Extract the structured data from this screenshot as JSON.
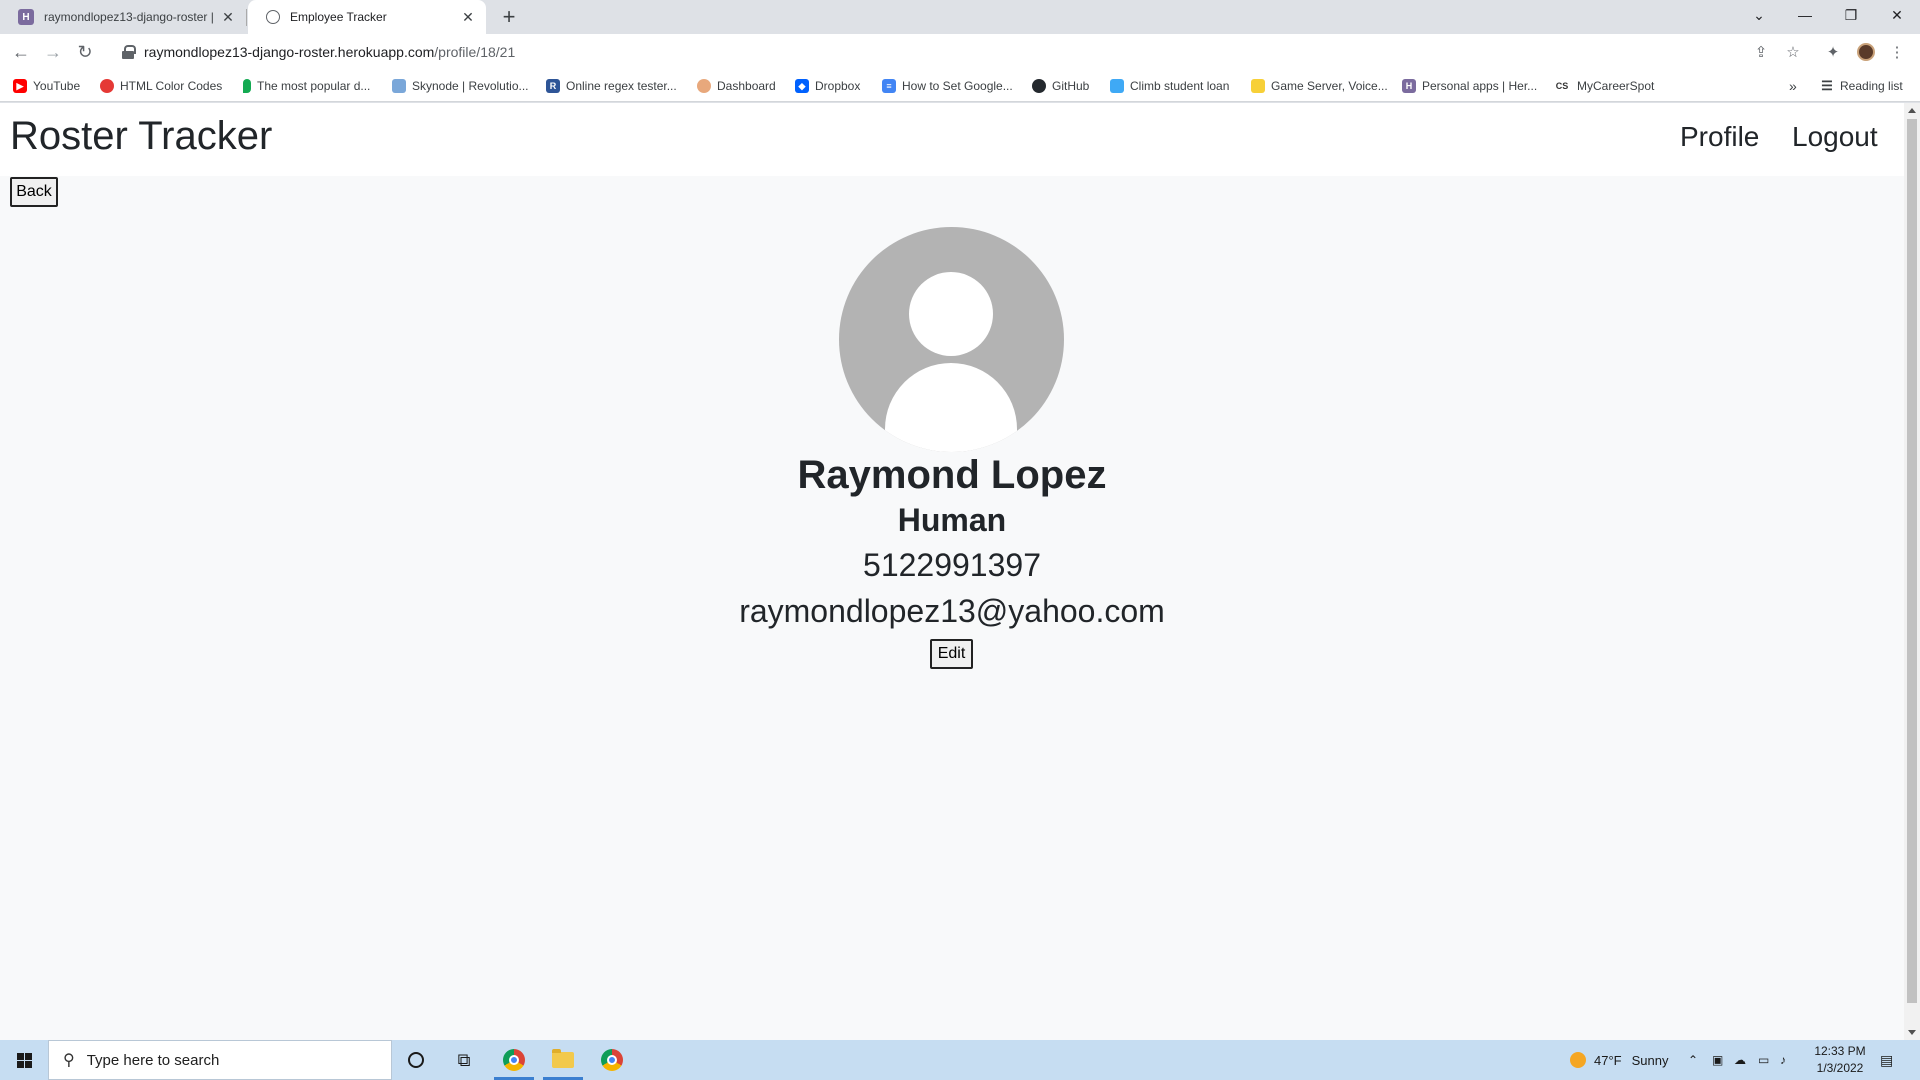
{
  "browser": {
    "tabs": [
      {
        "title": "raymondlopez13-django-roster |",
        "icon": "heroku-icon",
        "active": false
      },
      {
        "title": "Employee Tracker",
        "icon": "globe-icon",
        "active": true
      }
    ],
    "new_tab_symbol": "+",
    "url_host": "raymondlopez13-django-roster.herokuapp.com",
    "url_path": "/profile/18/21",
    "bookmarks": [
      {
        "label": "YouTube",
        "icon": "youtube-icon",
        "color": "#ff0000"
      },
      {
        "label": "HTML Color Codes",
        "icon": "color-codes-icon",
        "color": "#e53935"
      },
      {
        "label": "The most popular d...",
        "icon": "mongodb-leaf-icon",
        "color": "#13aa52"
      },
      {
        "label": "Skynode | Revolutio...",
        "icon": "skynode-icon",
        "color": "#7aa7d9"
      },
      {
        "label": "Online regex tester...",
        "icon": "regex-icon",
        "color": "#2e5597"
      },
      {
        "label": "Dashboard",
        "icon": "dashboard-icon",
        "color": "#e8a87c"
      },
      {
        "label": "Dropbox",
        "icon": "dropbox-icon",
        "color": "#0061fe"
      },
      {
        "label": "How to Set Google...",
        "icon": "google-docs-icon",
        "color": "#4285f4"
      },
      {
        "label": "GitHub",
        "icon": "github-icon",
        "color": "#24292e"
      },
      {
        "label": "Climb student loan",
        "icon": "climb-icon",
        "color": "#3fa9f5"
      },
      {
        "label": "Game Server, Voice...",
        "icon": "game-server-icon",
        "color": "#f7d038"
      },
      {
        "label": "Personal apps | Her...",
        "icon": "heroku-icon",
        "color": "#7b6b9e"
      },
      {
        "label": "MyCareerSpot",
        "icon": "cs-icon",
        "color": "#333333"
      }
    ],
    "bookmarks_overflow": "»",
    "reading_list": "Reading list"
  },
  "page": {
    "brand": "Roster Tracker",
    "nav": {
      "profile": "Profile",
      "logout": "Logout"
    },
    "back_button": "Back",
    "profile": {
      "name": "Raymond Lopez",
      "role": "Human",
      "phone": "5122991397",
      "email": "raymondlopez13@yahoo.com"
    },
    "edit_button": "Edit"
  },
  "taskbar": {
    "search_placeholder": "Type here to search",
    "weather_temp": "47°F",
    "weather_text": "Sunny",
    "time": "12:33 PM",
    "date": "1/3/2022"
  },
  "colors": {
    "page_bg": "#f8f9fa",
    "avatar_bg": "#b3b3b3",
    "taskbar_bg": "#c6ddf2"
  }
}
